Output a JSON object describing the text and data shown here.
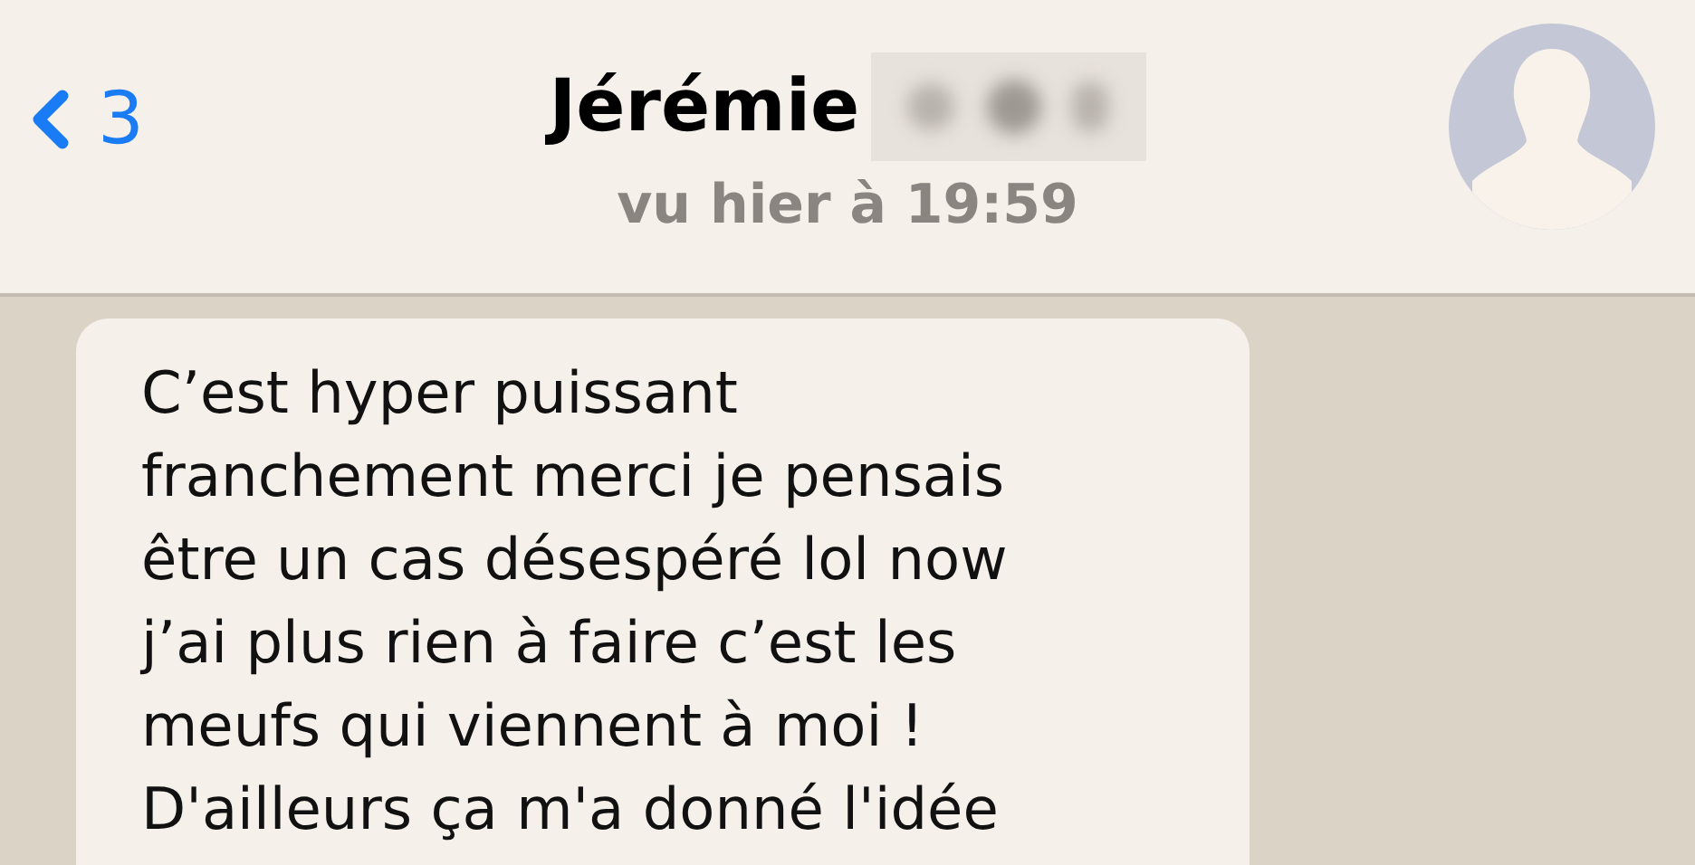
{
  "header": {
    "back_count": "3",
    "contact_name": "Jérémie",
    "name_blurred": true,
    "last_seen": "vu hier à 19:59"
  },
  "messages": [
    {
      "kind": "incoming",
      "text": "C’est hyper puissant\nfranchement merci je pensais\nêtre un cas désespéré lol now\nj’ai plus rien à faire c’est les\nmeufs qui viennent à moi !\nD'ailleurs ça m'a donné l'idée"
    }
  ]
}
